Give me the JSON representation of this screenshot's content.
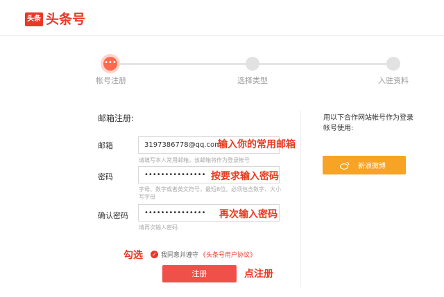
{
  "logo": {
    "badge": "头条",
    "title": "头条号"
  },
  "steps": [
    {
      "label": "帐号注册",
      "icon": "ellipsis"
    },
    {
      "label": "选择类型"
    },
    {
      "label": "入驻资料"
    }
  ],
  "form": {
    "section_title": "邮箱注册:",
    "email": {
      "label": "邮箱",
      "value": "3197386778@qq.com",
      "hint": "请填写本人常用邮箱，该邮箱将作为登录帐号"
    },
    "password": {
      "label": "密码",
      "value": "•••••••••••••••",
      "hint": "字母、数字或者英文符号，最短8位。必须包含数字、大小写字母"
    },
    "confirm": {
      "label": "确认密码",
      "value": "•••••••••••••••",
      "hint": "请再次输入密码"
    },
    "agree_text": "我同意并遵守",
    "agree_link": "《头条号用户协议》",
    "submit_label": "注册"
  },
  "annotations": {
    "email": "输入你的常用邮箱",
    "password": "按要求输入密码",
    "confirm": "再次输入密码",
    "check": "勾选",
    "submit": "点注册"
  },
  "sidebar": {
    "partner_text": "用以下合作网站帐号作为登录帐号使用:",
    "weibo_label": "新浪微博"
  },
  "colors": {
    "brand": "#e8382a",
    "weibo": "#f7a325"
  }
}
